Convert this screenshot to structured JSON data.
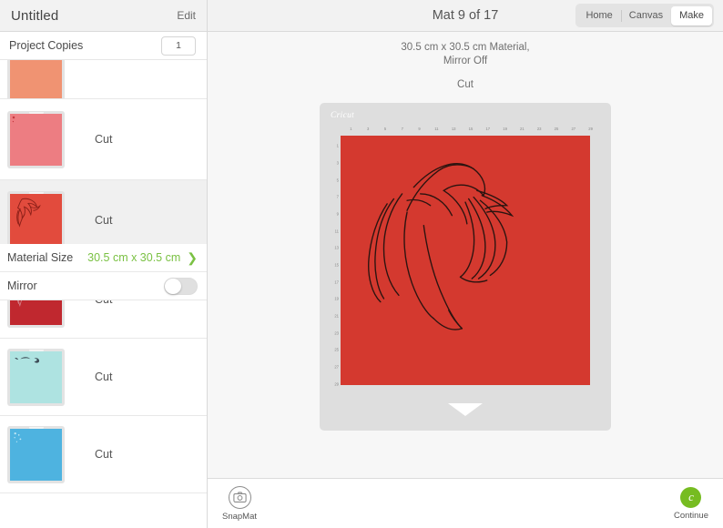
{
  "sidebar": {
    "project_title": "Untitled",
    "edit_label": "Edit",
    "copies_label": "Project Copies",
    "copies_value": "1",
    "material_size_label": "Material Size",
    "material_size_value": "30.5 cm x 30.5 cm",
    "mirror_label": "Mirror",
    "mirror_on": false,
    "mats": [
      {
        "cut_label": "",
        "color": "#f09372",
        "clipped": true,
        "selected": false,
        "art": "none"
      },
      {
        "cut_label": "Cut",
        "color": "#ed7d82",
        "clipped": false,
        "selected": false,
        "art": "specks"
      },
      {
        "cut_label": "Cut",
        "color": "#e24b3d",
        "clipped": false,
        "selected": true,
        "art": "hair"
      },
      {
        "cut_label": "Cut",
        "color": "#c0282f",
        "clipped": false,
        "selected": false,
        "art": "hair-light"
      },
      {
        "cut_label": "Cut",
        "color": "#aee3e1",
        "clipped": false,
        "selected": false,
        "art": "brows"
      },
      {
        "cut_label": "Cut",
        "color": "#4eb3e0",
        "clipped": false,
        "selected": false,
        "art": "specks"
      }
    ]
  },
  "header": {
    "title": "Mat 9 of 17",
    "segments": [
      {
        "label": "Home",
        "active": false
      },
      {
        "label": "Canvas",
        "active": false
      },
      {
        "label": "Make",
        "active": true
      }
    ]
  },
  "mat_info": {
    "material_line": "30.5 cm x 30.5 cm Material,",
    "mirror_line": "Mirror Off",
    "operation": "Cut"
  },
  "canvas": {
    "brand": "Cricut",
    "material_color": "#d4392f",
    "ruler_ticks": [
      "1",
      "3",
      "5",
      "7",
      "9",
      "11",
      "13",
      "15",
      "17",
      "19",
      "21",
      "23",
      "25",
      "27",
      "29"
    ]
  },
  "bottombar": {
    "snapmat_label": "SnapMat",
    "continue_label": "Continue",
    "continue_glyph": "c",
    "continue_color": "#76bc21"
  }
}
